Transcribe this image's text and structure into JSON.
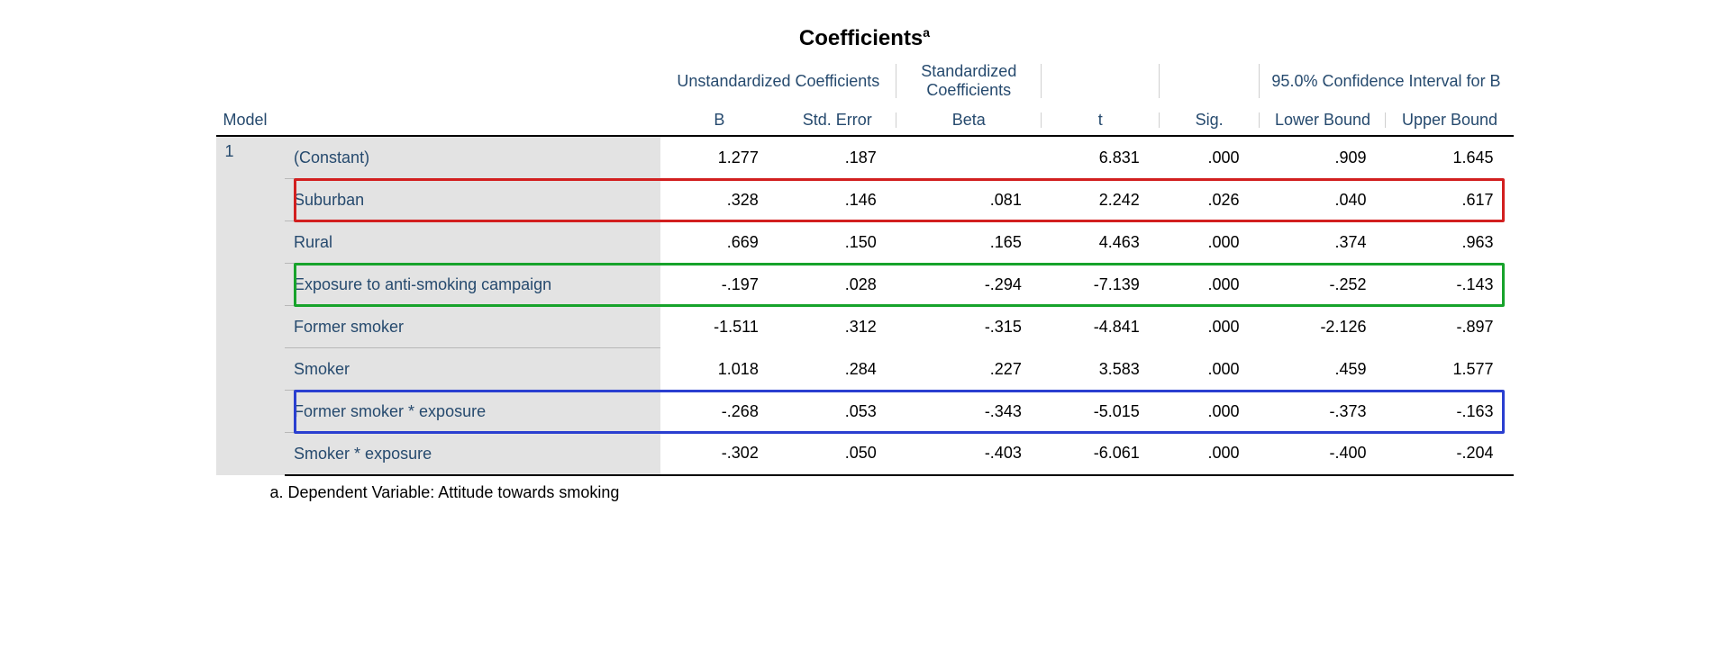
{
  "title": "Coefficients",
  "title_sup": "a",
  "header": {
    "model": "Model",
    "unstd": "Unstandardized Coefficients",
    "std": "Standardized Coefficients",
    "ci": "95.0% Confidence Interval for B",
    "b": "B",
    "se": "Std. Error",
    "beta": "Beta",
    "t": "t",
    "sig": "Sig.",
    "lb": "Lower Bound",
    "ub": "Upper Bound"
  },
  "model_number": "1",
  "rows": [
    {
      "label": "(Constant)",
      "b": "1.277",
      "se": ".187",
      "beta": "",
      "t": "6.831",
      "sig": ".000",
      "lb": ".909",
      "ub": "1.645"
    },
    {
      "label": "Suburban",
      "b": ".328",
      "se": ".146",
      "beta": ".081",
      "t": "2.242",
      "sig": ".026",
      "lb": ".040",
      "ub": ".617"
    },
    {
      "label": "Rural",
      "b": ".669",
      "se": ".150",
      "beta": ".165",
      "t": "4.463",
      "sig": ".000",
      "lb": ".374",
      "ub": ".963"
    },
    {
      "label": "Exposure to anti-smoking campaign",
      "b": "-.197",
      "se": ".028",
      "beta": "-.294",
      "t": "-7.139",
      "sig": ".000",
      "lb": "-.252",
      "ub": "-.143"
    },
    {
      "label": "Former smoker",
      "b": "-1.511",
      "se": ".312",
      "beta": "-.315",
      "t": "-4.841",
      "sig": ".000",
      "lb": "-2.126",
      "ub": "-.897"
    },
    {
      "label": "Smoker",
      "b": "1.018",
      "se": ".284",
      "beta": ".227",
      "t": "3.583",
      "sig": ".000",
      "lb": ".459",
      "ub": "1.577"
    },
    {
      "label": "Former smoker * exposure",
      "b": "-.268",
      "se": ".053",
      "beta": "-.343",
      "t": "-5.015",
      "sig": ".000",
      "lb": "-.373",
      "ub": "-.163"
    },
    {
      "label": "Smoker * exposure",
      "b": "-.302",
      "se": ".050",
      "beta": "-.403",
      "t": "-6.061",
      "sig": ".000",
      "lb": "-.400",
      "ub": "-.204"
    }
  ],
  "footnote": "a. Dependent Variable: Attitude towards smoking",
  "highlights": [
    {
      "row": 1,
      "color": "#D21F1F"
    },
    {
      "row": 3,
      "color": "#17A32B"
    },
    {
      "row": 6,
      "color": "#2A3FD0"
    }
  ]
}
